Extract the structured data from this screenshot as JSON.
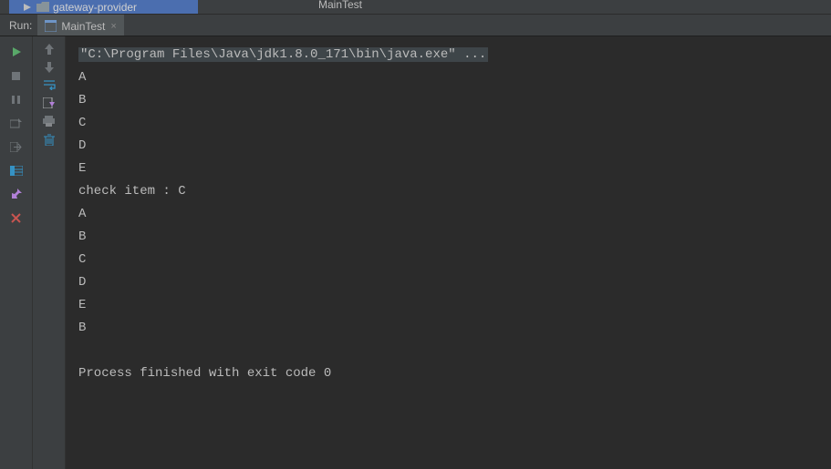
{
  "topStrip": {
    "projectName": "gateway-provider",
    "breadcrumbFile": "MainTest"
  },
  "runBar": {
    "label": "Run:",
    "tab": {
      "name": "MainTest"
    }
  },
  "console": {
    "commandLine": "\"C:\\Program Files\\Java\\jdk1.8.0_171\\bin\\java.exe\" ...",
    "outputLines": [
      "A",
      "B",
      "C",
      "D",
      "E",
      "check item : C",
      "A",
      "B",
      "C",
      "D",
      "E",
      "B",
      "",
      "Process finished with exit code 0"
    ]
  },
  "icons": {
    "run": "run",
    "stop": "stop",
    "pause": "pause",
    "restore": "restore",
    "exit": "exit",
    "layout": "layout",
    "pin": "pin",
    "close": "close",
    "upArrow": "up",
    "downArrow": "down",
    "wrap": "wrap",
    "scroll": "scroll",
    "print": "print",
    "trash": "trash"
  }
}
